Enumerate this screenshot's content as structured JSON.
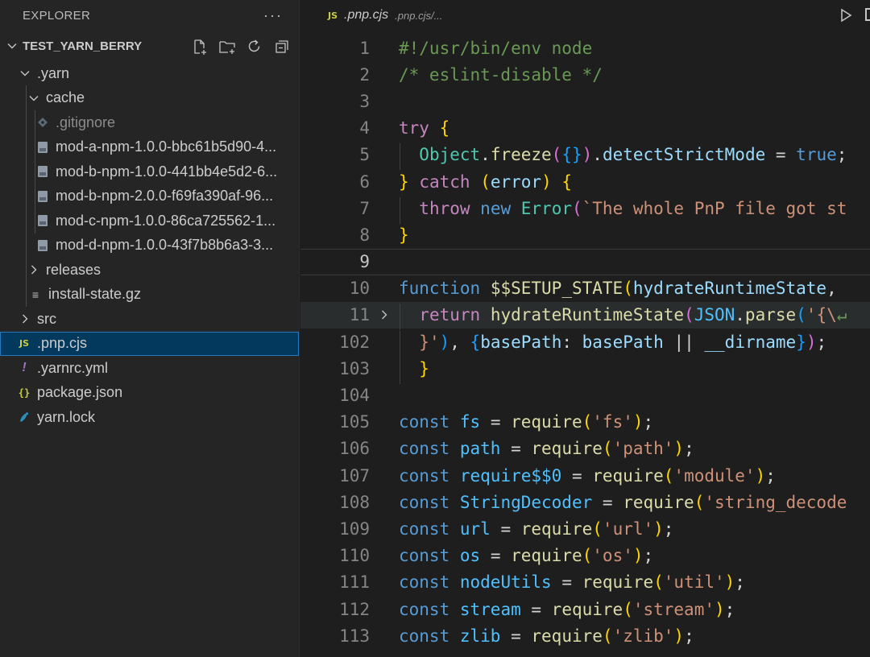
{
  "explorer": {
    "title": "EXPLORER",
    "more_label": "···",
    "project": "TEST_YARN_BERRY",
    "project_actions": [
      "new-file-icon",
      "new-folder-icon",
      "refresh-icon",
      "collapse-all-icon"
    ],
    "items": [
      {
        "label": ".yarn",
        "kind": "folder",
        "expanded": true,
        "depth": 1
      },
      {
        "label": "cache",
        "kind": "folder",
        "expanded": true,
        "depth": 2
      },
      {
        "label": ".gitignore",
        "kind": "gitignore",
        "depth": 3
      },
      {
        "label": "mod-a-npm-1.0.0-bbc61b5d90-4...",
        "kind": "zip",
        "depth": 3
      },
      {
        "label": "mod-b-npm-1.0.0-441bb4e5d2-6...",
        "kind": "zip",
        "depth": 3
      },
      {
        "label": "mod-b-npm-2.0.0-f69fa390af-96...",
        "kind": "zip",
        "depth": 3
      },
      {
        "label": "mod-c-npm-1.0.0-86ca725562-1...",
        "kind": "zip",
        "depth": 3
      },
      {
        "label": "mod-d-npm-1.0.0-43f7b8b6a3-3...",
        "kind": "zip",
        "depth": 3
      },
      {
        "label": "releases",
        "kind": "folder",
        "expanded": false,
        "depth": 2
      },
      {
        "label": "install-state.gz",
        "kind": "text",
        "depth": 2
      },
      {
        "label": "src",
        "kind": "folder",
        "expanded": false,
        "depth": 1
      },
      {
        "label": ".pnp.cjs",
        "kind": "js",
        "depth": 1,
        "selected": true
      },
      {
        "label": ".yarnrc.yml",
        "kind": "yml",
        "depth": 1
      },
      {
        "label": "package.json",
        "kind": "json",
        "depth": 1
      },
      {
        "label": "yarn.lock",
        "kind": "yarn",
        "depth": 1
      }
    ]
  },
  "editor": {
    "tab_badge": "JS",
    "file_name": ".pnp.cjs",
    "file_path": ".pnp.cjs/...",
    "run_icon": "run-icon",
    "split_icon": "split-editor-icon"
  },
  "code": [
    {
      "num": "1",
      "tokens": [
        [
          "t-comment",
          "#!/usr/bin/env node"
        ]
      ]
    },
    {
      "num": "2",
      "tokens": [
        [
          "t-comment",
          "/* eslint-disable */"
        ]
      ]
    },
    {
      "num": "3",
      "tokens": []
    },
    {
      "num": "4",
      "tokens": [
        [
          "t-kw",
          "try"
        ],
        [
          "t-op",
          " "
        ],
        [
          "t-b1",
          "{"
        ]
      ]
    },
    {
      "num": "5",
      "tokens": [
        [
          "t-op",
          "  "
        ],
        [
          "t-class",
          "Object"
        ],
        [
          "t-op",
          "."
        ],
        [
          "t-fn",
          "freeze"
        ],
        [
          "t-b2",
          "("
        ],
        [
          "t-b3",
          "{}"
        ],
        [
          "t-b2",
          ")"
        ],
        [
          "t-op",
          "."
        ],
        [
          "t-var",
          "detectStrictMode"
        ],
        [
          "t-op",
          " = "
        ],
        [
          "t-decl",
          "true"
        ],
        [
          "t-op",
          ";"
        ]
      ]
    },
    {
      "num": "6",
      "tokens": [
        [
          "t-b1",
          "}"
        ],
        [
          "t-op",
          " "
        ],
        [
          "t-kw",
          "catch"
        ],
        [
          "t-op",
          " "
        ],
        [
          "t-b1",
          "("
        ],
        [
          "t-var",
          "error"
        ],
        [
          "t-b1",
          ")"
        ],
        [
          "t-op",
          " "
        ],
        [
          "t-b1",
          "{"
        ]
      ]
    },
    {
      "num": "7",
      "tokens": [
        [
          "t-op",
          "  "
        ],
        [
          "t-kw",
          "throw"
        ],
        [
          "t-op",
          " "
        ],
        [
          "t-decl",
          "new"
        ],
        [
          "t-op",
          " "
        ],
        [
          "t-class",
          "Error"
        ],
        [
          "t-b2",
          "("
        ],
        [
          "t-str",
          "`The whole PnP file got st"
        ]
      ]
    },
    {
      "num": "8",
      "tokens": [
        [
          "t-b1",
          "}"
        ]
      ]
    },
    {
      "num": "9",
      "tokens": [],
      "active": true
    },
    {
      "num": "10",
      "tokens": [
        [
          "t-decl",
          "function"
        ],
        [
          "t-op",
          " "
        ],
        [
          "t-fn",
          "$$SETUP_STATE"
        ],
        [
          "t-b1",
          "("
        ],
        [
          "t-var",
          "hydrateRuntimeState"
        ],
        [
          "t-op",
          ", "
        ]
      ]
    },
    {
      "num": "11",
      "tokens": [
        [
          "t-op",
          "  "
        ],
        [
          "t-kw",
          "return"
        ],
        [
          "t-op",
          " "
        ],
        [
          "t-fn",
          "hydrateRuntimeState"
        ],
        [
          "t-b2",
          "("
        ],
        [
          "t-const",
          "JSON"
        ],
        [
          "t-op",
          "."
        ],
        [
          "t-fn",
          "parse"
        ],
        [
          "t-b3",
          "("
        ],
        [
          "t-str",
          "'{\\"
        ],
        [
          "t-comment",
          "↵"
        ]
      ],
      "folded": true,
      "highlight": true
    },
    {
      "num": "102",
      "tokens": [
        [
          "t-op",
          "  "
        ],
        [
          "t-str",
          "}'"
        ],
        [
          "t-b3",
          ")"
        ],
        [
          "t-op",
          ", "
        ],
        [
          "t-b3",
          "{"
        ],
        [
          "t-var",
          "basePath"
        ],
        [
          "t-op",
          ": "
        ],
        [
          "t-var",
          "basePath"
        ],
        [
          "t-op",
          " || "
        ],
        [
          "t-var",
          "__dirname"
        ],
        [
          "t-b3",
          "}"
        ],
        [
          "t-b2",
          ")"
        ],
        [
          "t-op",
          ";"
        ]
      ]
    },
    {
      "num": "103",
      "tokens": [
        [
          "t-op",
          "  "
        ],
        [
          "t-b1",
          "}"
        ]
      ]
    },
    {
      "num": "104",
      "tokens": []
    },
    {
      "num": "105",
      "tokens": [
        [
          "t-decl",
          "const"
        ],
        [
          "t-op",
          " "
        ],
        [
          "t-const",
          "fs"
        ],
        [
          "t-op",
          " = "
        ],
        [
          "t-fn",
          "require"
        ],
        [
          "t-b1",
          "("
        ],
        [
          "t-str",
          "'fs'"
        ],
        [
          "t-b1",
          ")"
        ],
        [
          "t-op",
          ";"
        ]
      ]
    },
    {
      "num": "106",
      "tokens": [
        [
          "t-decl",
          "const"
        ],
        [
          "t-op",
          " "
        ],
        [
          "t-const",
          "path"
        ],
        [
          "t-op",
          " = "
        ],
        [
          "t-fn",
          "require"
        ],
        [
          "t-b1",
          "("
        ],
        [
          "t-str",
          "'path'"
        ],
        [
          "t-b1",
          ")"
        ],
        [
          "t-op",
          ";"
        ]
      ]
    },
    {
      "num": "107",
      "tokens": [
        [
          "t-decl",
          "const"
        ],
        [
          "t-op",
          " "
        ],
        [
          "t-const",
          "require$$0"
        ],
        [
          "t-op",
          " = "
        ],
        [
          "t-fn",
          "require"
        ],
        [
          "t-b1",
          "("
        ],
        [
          "t-str",
          "'module'"
        ],
        [
          "t-b1",
          ")"
        ],
        [
          "t-op",
          ";"
        ]
      ]
    },
    {
      "num": "108",
      "tokens": [
        [
          "t-decl",
          "const"
        ],
        [
          "t-op",
          " "
        ],
        [
          "t-const",
          "StringDecoder"
        ],
        [
          "t-op",
          " = "
        ],
        [
          "t-fn",
          "require"
        ],
        [
          "t-b1",
          "("
        ],
        [
          "t-str",
          "'string_decode"
        ]
      ]
    },
    {
      "num": "109",
      "tokens": [
        [
          "t-decl",
          "const"
        ],
        [
          "t-op",
          " "
        ],
        [
          "t-const",
          "url"
        ],
        [
          "t-op",
          " = "
        ],
        [
          "t-fn",
          "require"
        ],
        [
          "t-b1",
          "("
        ],
        [
          "t-str",
          "'url'"
        ],
        [
          "t-b1",
          ")"
        ],
        [
          "t-op",
          ";"
        ]
      ]
    },
    {
      "num": "110",
      "tokens": [
        [
          "t-decl",
          "const"
        ],
        [
          "t-op",
          " "
        ],
        [
          "t-const",
          "os"
        ],
        [
          "t-op",
          " = "
        ],
        [
          "t-fn",
          "require"
        ],
        [
          "t-b1",
          "("
        ],
        [
          "t-str",
          "'os'"
        ],
        [
          "t-b1",
          ")"
        ],
        [
          "t-op",
          ";"
        ]
      ]
    },
    {
      "num": "111",
      "tokens": [
        [
          "t-decl",
          "const"
        ],
        [
          "t-op",
          " "
        ],
        [
          "t-const",
          "nodeUtils"
        ],
        [
          "t-op",
          " = "
        ],
        [
          "t-fn",
          "require"
        ],
        [
          "t-b1",
          "("
        ],
        [
          "t-str",
          "'util'"
        ],
        [
          "t-b1",
          ")"
        ],
        [
          "t-op",
          ";"
        ]
      ]
    },
    {
      "num": "112",
      "tokens": [
        [
          "t-decl",
          "const"
        ],
        [
          "t-op",
          " "
        ],
        [
          "t-const",
          "stream"
        ],
        [
          "t-op",
          " = "
        ],
        [
          "t-fn",
          "require"
        ],
        [
          "t-b1",
          "("
        ],
        [
          "t-str",
          "'stream'"
        ],
        [
          "t-b1",
          ")"
        ],
        [
          "t-op",
          ";"
        ]
      ]
    },
    {
      "num": "113",
      "tokens": [
        [
          "t-decl",
          "const"
        ],
        [
          "t-op",
          " "
        ],
        [
          "t-const",
          "zlib"
        ],
        [
          "t-op",
          " = "
        ],
        [
          "t-fn",
          "require"
        ],
        [
          "t-b1",
          "("
        ],
        [
          "t-str",
          "'zlib'"
        ],
        [
          "t-b1",
          ")"
        ],
        [
          "t-op",
          ";"
        ]
      ]
    }
  ]
}
